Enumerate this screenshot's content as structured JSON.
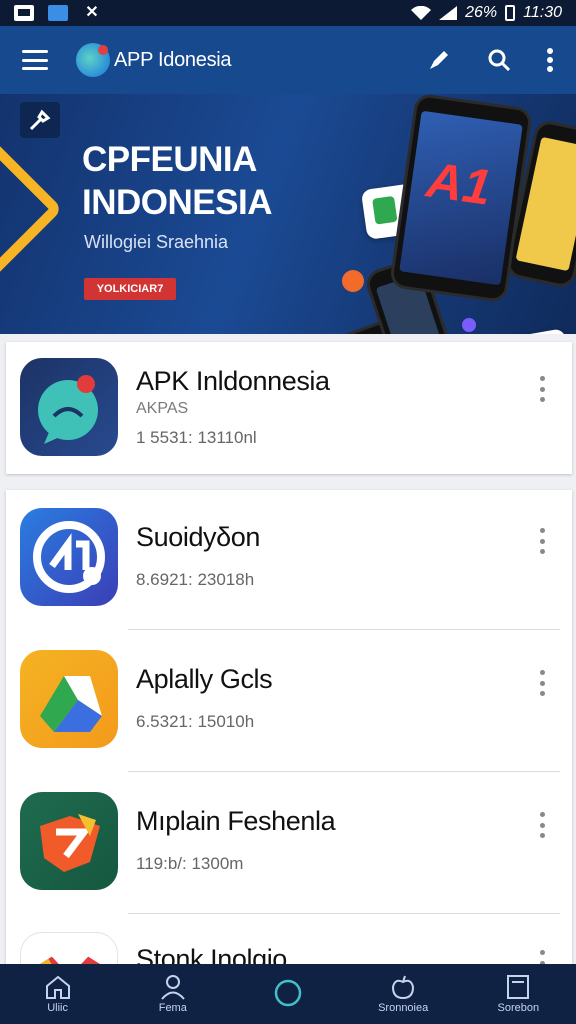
{
  "status_bar": {
    "battery_text": "26%",
    "time": "11:30",
    "icons": [
      "message-icon",
      "photo-icon",
      "close-icon",
      "wifi-icon",
      "signal-icon",
      "battery-icon"
    ]
  },
  "app_bar": {
    "title": "APP Idonesia",
    "icons": [
      "menu-icon",
      "logo-icon",
      "pen-icon",
      "search-icon",
      "more-vert-icon"
    ]
  },
  "banner": {
    "title_line1": "CPFEUNIA",
    "title_line2": "INDONESIA",
    "subtitle": "Willogiei Sraehnia",
    "button_label": "YOLKICIAR7",
    "phone_text": "A1"
  },
  "featured_app": {
    "name": "APK Inldonnesia",
    "publisher": "AKPAS",
    "meta": "1 5531: 13110nl"
  },
  "apps": [
    {
      "name": "Suoidyδon",
      "meta": "8.6921: 23018h"
    },
    {
      "name": "Aplally Gcls",
      "meta": "6.5321: 15010h"
    },
    {
      "name": "Mıplain Feshenla",
      "meta": "119:b/: 1300m"
    },
    {
      "name": "Stonk Inolgio",
      "meta": ""
    }
  ],
  "bottom_nav": [
    {
      "label": "Uliic",
      "icon": "home-icon"
    },
    {
      "label": "Fema",
      "icon": "profile-icon"
    },
    {
      "label": "",
      "icon": "circle-icon"
    },
    {
      "label": "Sronnoiea",
      "icon": "apple-icon"
    },
    {
      "label": "Sorebon",
      "icon": "screen-icon"
    }
  ],
  "colors": {
    "app_bar": "#17498f",
    "status_bar": "#0d1a33",
    "banner_accent": "#f7b424",
    "banner_button": "#d23434",
    "bottom_nav": "#0f2244"
  }
}
